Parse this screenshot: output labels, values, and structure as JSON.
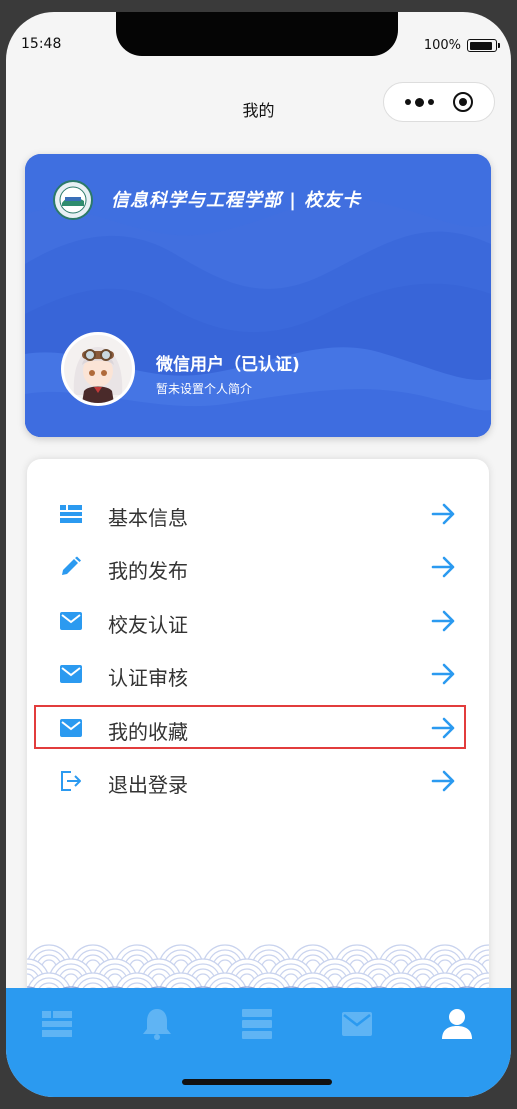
{
  "status": {
    "time": "15:48",
    "battery": "100%"
  },
  "nav": {
    "title": "我的"
  },
  "card": {
    "title": "信息科学与工程学部 | 校友卡",
    "user_name": "微信用户（已认证)",
    "user_bio": "暂未设置个人简介"
  },
  "menu": {
    "items": [
      {
        "label": "基本信息",
        "icon": "grid-list-icon"
      },
      {
        "label": "我的发布",
        "icon": "pencil-icon"
      },
      {
        "label": "校友认证",
        "icon": "envelope-icon"
      },
      {
        "label": "认证审核",
        "icon": "envelope-icon"
      },
      {
        "label": "我的收藏",
        "icon": "envelope-icon"
      },
      {
        "label": "退出登录",
        "icon": "logout-icon"
      }
    ],
    "highlighted_index": 4
  },
  "tabbar": {
    "tabs": [
      {
        "icon": "list-icon",
        "active": false
      },
      {
        "icon": "bell-icon",
        "active": false
      },
      {
        "icon": "server-icon",
        "active": false
      },
      {
        "icon": "envelope-icon",
        "active": false
      },
      {
        "icon": "user-icon",
        "active": true
      }
    ]
  },
  "colors": {
    "accent": "#2b9af0",
    "card_blue": "#3f6fe0",
    "tab_inactive": "#5fb4f4",
    "tab_active": "#ffffff",
    "highlight": "#e23c3c"
  }
}
